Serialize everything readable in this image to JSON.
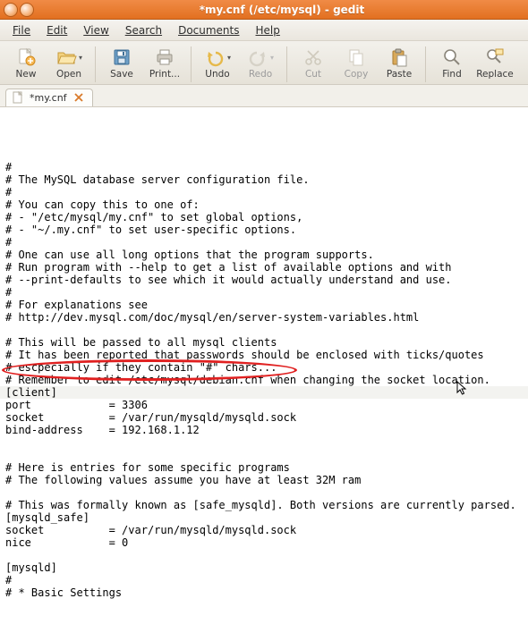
{
  "window": {
    "title": "*my.cnf (/etc/mysql) - gedit"
  },
  "menubar": {
    "items": [
      {
        "label": "File",
        "u": 0
      },
      {
        "label": "Edit",
        "u": 0
      },
      {
        "label": "View",
        "u": 0
      },
      {
        "label": "Search",
        "u": 0
      },
      {
        "label": "Documents",
        "u": 0
      },
      {
        "label": "Help",
        "u": 0
      }
    ]
  },
  "toolbar": {
    "new": "New",
    "open": "Open",
    "save": "Save",
    "print": "Print...",
    "undo": "Undo",
    "redo": "Redo",
    "cut": "Cut",
    "copy": "Copy",
    "paste": "Paste",
    "find": "Find",
    "replace": "Replace"
  },
  "tab": {
    "label": "*my.cnf"
  },
  "editor": {
    "lines": [
      "#",
      "# The MySQL database server configuration file.",
      "#",
      "# You can copy this to one of:",
      "# - \"/etc/mysql/my.cnf\" to set global options,",
      "# - \"~/.my.cnf\" to set user-specific options.",
      "#",
      "# One can use all long options that the program supports.",
      "# Run program with --help to get a list of available options and with",
      "# --print-defaults to see which it would actually understand and use.",
      "#",
      "# For explanations see",
      "# http://dev.mysql.com/doc/mysql/en/server-system-variables.html",
      "",
      "# This will be passed to all mysql clients",
      "# It has been reported that passwords should be enclosed with ticks/quotes",
      "# escpecially if they contain \"#\" chars...",
      "# Remember to edit /etc/mysql/debian.cnf when changing the socket location.",
      "[client]",
      "port            = 3306",
      "socket          = /var/run/mysqld/mysqld.sock",
      "bind-address    = 192.168.1.12",
      "",
      "",
      "# Here is entries for some specific programs",
      "# The following values assume you have at least 32M ram",
      "",
      "# This was formally known as [safe_mysqld]. Both versions are currently parsed.",
      "[mysqld_safe]",
      "socket          = /var/run/mysqld/mysqld.sock",
      "nice            = 0",
      "",
      "[mysqld]",
      "#",
      "# * Basic Settings"
    ]
  }
}
